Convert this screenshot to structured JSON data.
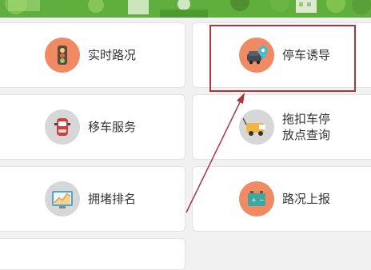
{
  "menu": {
    "traffic_status": "实时路况",
    "parking_guidance": "停车诱导",
    "move_car_service": "移车服务",
    "towed_car_lookup_line1": "拖扣车停",
    "towed_car_lookup_line2": "放点查询",
    "congestion_ranking": "拥堵排名",
    "road_report": "路况上报"
  },
  "icons": {
    "traffic_light": "traffic-light-icon",
    "map_pin_car": "map-pin-car-icon",
    "car": "car-icon",
    "tow_truck": "tow-truck-icon",
    "chart": "chart-icon",
    "battery": "battery-icon"
  },
  "colors": {
    "banner_green": "#5fae3e",
    "icon_orange": "#ef8a62",
    "icon_gray": "#d5d5d5",
    "highlight_red": "#b0353b"
  }
}
